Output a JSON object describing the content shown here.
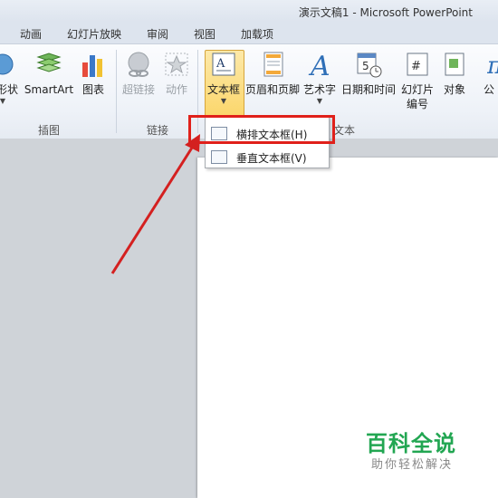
{
  "window": {
    "title": "演示文稿1 - Microsoft PowerPoint"
  },
  "tabs": [
    "动画",
    "幻灯片放映",
    "审阅",
    "视图",
    "加载项"
  ],
  "ribbon": {
    "buttons": {
      "shapes_partial": "形状",
      "smartart": "SmartArt",
      "chart": "图表",
      "hyperlink": "超链接",
      "action": "动作",
      "textbox": "文本框",
      "header_footer": "页眉和页脚",
      "wordart": "艺术字",
      "datetime": "日期和时间",
      "slide_number_l1": "幻灯片",
      "slide_number_l2": "编号",
      "object": "对象",
      "equation_partial": "公"
    },
    "groups": {
      "illustrations": "插图",
      "links": "链接",
      "text": "文本"
    }
  },
  "dropdown": {
    "horizontal_textbox": "横排文本框(H)",
    "vertical_textbox": "垂直文本框(V)"
  },
  "watermark": {
    "title": "百科全说",
    "subtitle": "助你轻松解决"
  },
  "colors": {
    "highlight": "#e0201a",
    "arrow": "#d42020",
    "watermark": "#22a652",
    "active_button": "#fbd66a"
  }
}
